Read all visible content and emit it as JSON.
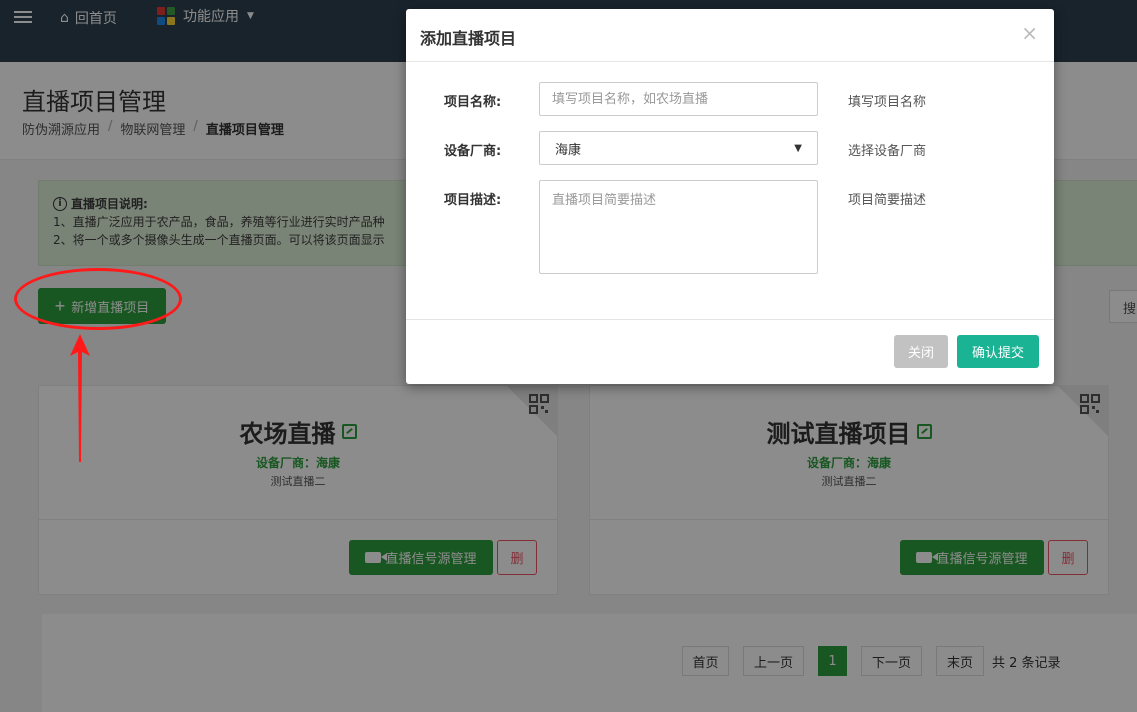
{
  "nav": {
    "home_label": "回首页",
    "apps_label": "功能应用"
  },
  "header": {
    "title": "直播项目管理",
    "breadcrumb": [
      "防伪溯源应用",
      "物联网管理",
      "直播项目管理"
    ],
    "separator": "/"
  },
  "alert": {
    "title": "直播项目说明:",
    "lines": [
      "1、直播广泛应用于农产品，食品，养殖等行业进行实时产品种",
      "2、将一个或多个摄像头生成一个直播页面。可以将该页面显示"
    ]
  },
  "toolbar": {
    "add_label": "新增直播项目",
    "search_label": "搜"
  },
  "cards": [
    {
      "name": "农场直播",
      "vendor": "设备厂商：海康",
      "desc": "测试直播二",
      "source_label": "直播信号源管理",
      "delete_label": "删"
    },
    {
      "name": "测试直播项目",
      "vendor": "设备厂商：海康",
      "desc": "测试直播二",
      "source_label": "直播信号源管理",
      "delete_label": "删"
    }
  ],
  "pagination": {
    "first": "首页",
    "prev": "上一页",
    "current": "1",
    "next": "下一页",
    "last": "末页",
    "total": "共 2 条记录"
  },
  "modal": {
    "title": "添加直播项目",
    "close_glyph": "×",
    "fields": {
      "name_label": "项目名称:",
      "name_placeholder": "填写项目名称，如农场直播",
      "name_help": "填写项目名称",
      "vendor_label": "设备厂商:",
      "vendor_value": "海康",
      "vendor_help": "选择设备厂商",
      "desc_label": "项目描述:",
      "desc_placeholder": "直播项目简要描述",
      "desc_help": "项目简要描述"
    },
    "close_label": "关闭",
    "submit_label": "确认提交"
  },
  "colors": {
    "nav_bg": "#2f4050",
    "primary_green": "#2c9e3c",
    "submit_teal": "#1ab394",
    "danger": "#ed5565",
    "annotation_red": "#ff1a1a"
  }
}
